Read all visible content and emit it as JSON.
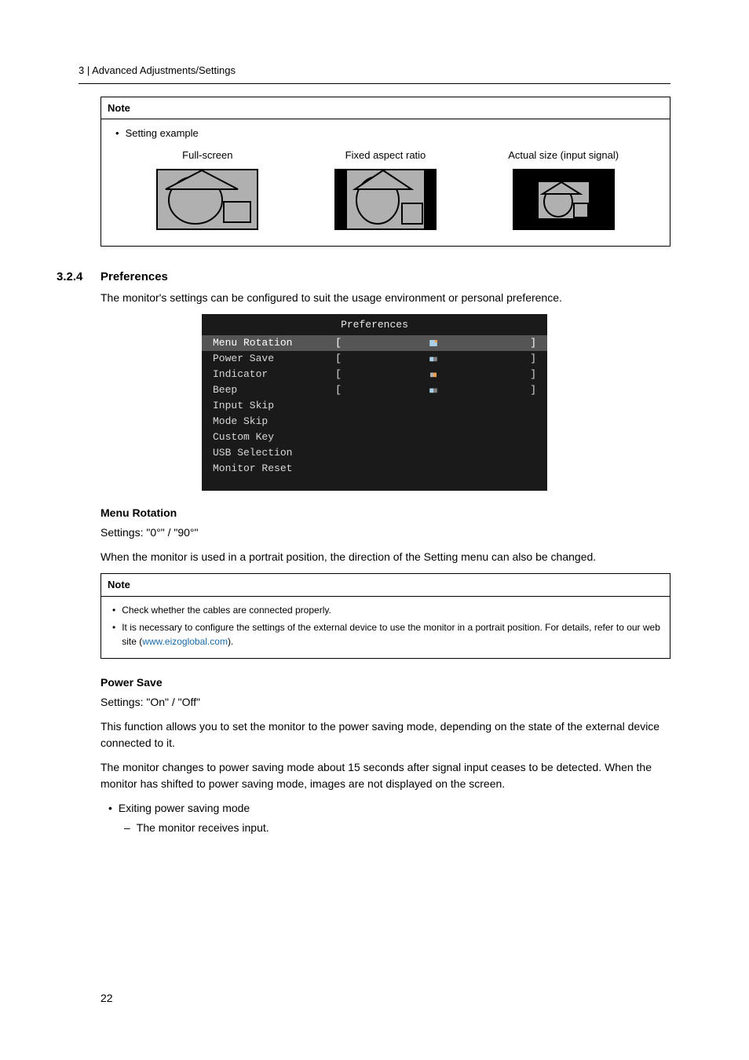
{
  "header": "3  |  Advanced Adjustments/Settings",
  "note1": {
    "title": "Note",
    "bullet": "Setting example",
    "cols": [
      "Full-screen",
      "Fixed aspect ratio",
      "Actual size (input signal)"
    ]
  },
  "sec": {
    "num": "3.2.4",
    "title": "Preferences"
  },
  "intro": "The monitor's settings can be configured to suit the usage environment or personal preference.",
  "osd": {
    "title": "Preferences",
    "rows": [
      {
        "label": "Menu Rotation",
        "hasVal": true,
        "selected": true,
        "icon": "rot"
      },
      {
        "label": "Power Save",
        "hasVal": true,
        "selected": false,
        "icon": "on"
      },
      {
        "label": "Indicator",
        "hasVal": true,
        "selected": false,
        "icon": "ind"
      },
      {
        "label": "Beep",
        "hasVal": true,
        "selected": false,
        "icon": "on"
      },
      {
        "label": "Input Skip",
        "hasVal": false,
        "selected": false
      },
      {
        "label": "Mode Skip",
        "hasVal": false,
        "selected": false
      },
      {
        "label": "Custom Key",
        "hasVal": false,
        "selected": false
      },
      {
        "label": "USB Selection",
        "hasVal": false,
        "selected": false
      },
      {
        "label": "Monitor Reset",
        "hasVal": false,
        "selected": false
      }
    ]
  },
  "menuRotation": {
    "head": "Menu Rotation",
    "settings": "Settings: \"0°\" / \"90°\"",
    "desc": "When the monitor is used in a portrait position, the direction of the Setting menu can also be changed."
  },
  "note2": {
    "title": "Note",
    "b1": "Check whether the cables are connected properly.",
    "b2a": "It is necessary to configure the settings of the external device to use the monitor in a portrait position. For details, refer to our web site (",
    "b2link": "www.eizoglobal.com",
    "b2b": ")."
  },
  "powerSave": {
    "head": "Power Save",
    "settings": "Settings: \"On\" / \"Off\"",
    "p1": "This function allows you to set the monitor to the power saving mode, depending on the state of the external device connected to it.",
    "p2": "The monitor changes to power saving mode about 15 seconds after signal input ceases to be detected. When the monitor has shifted to power saving mode, images are not displayed on the screen.",
    "li1": "Exiting power saving mode",
    "li2": "The monitor receives input."
  },
  "pageNum": "22"
}
